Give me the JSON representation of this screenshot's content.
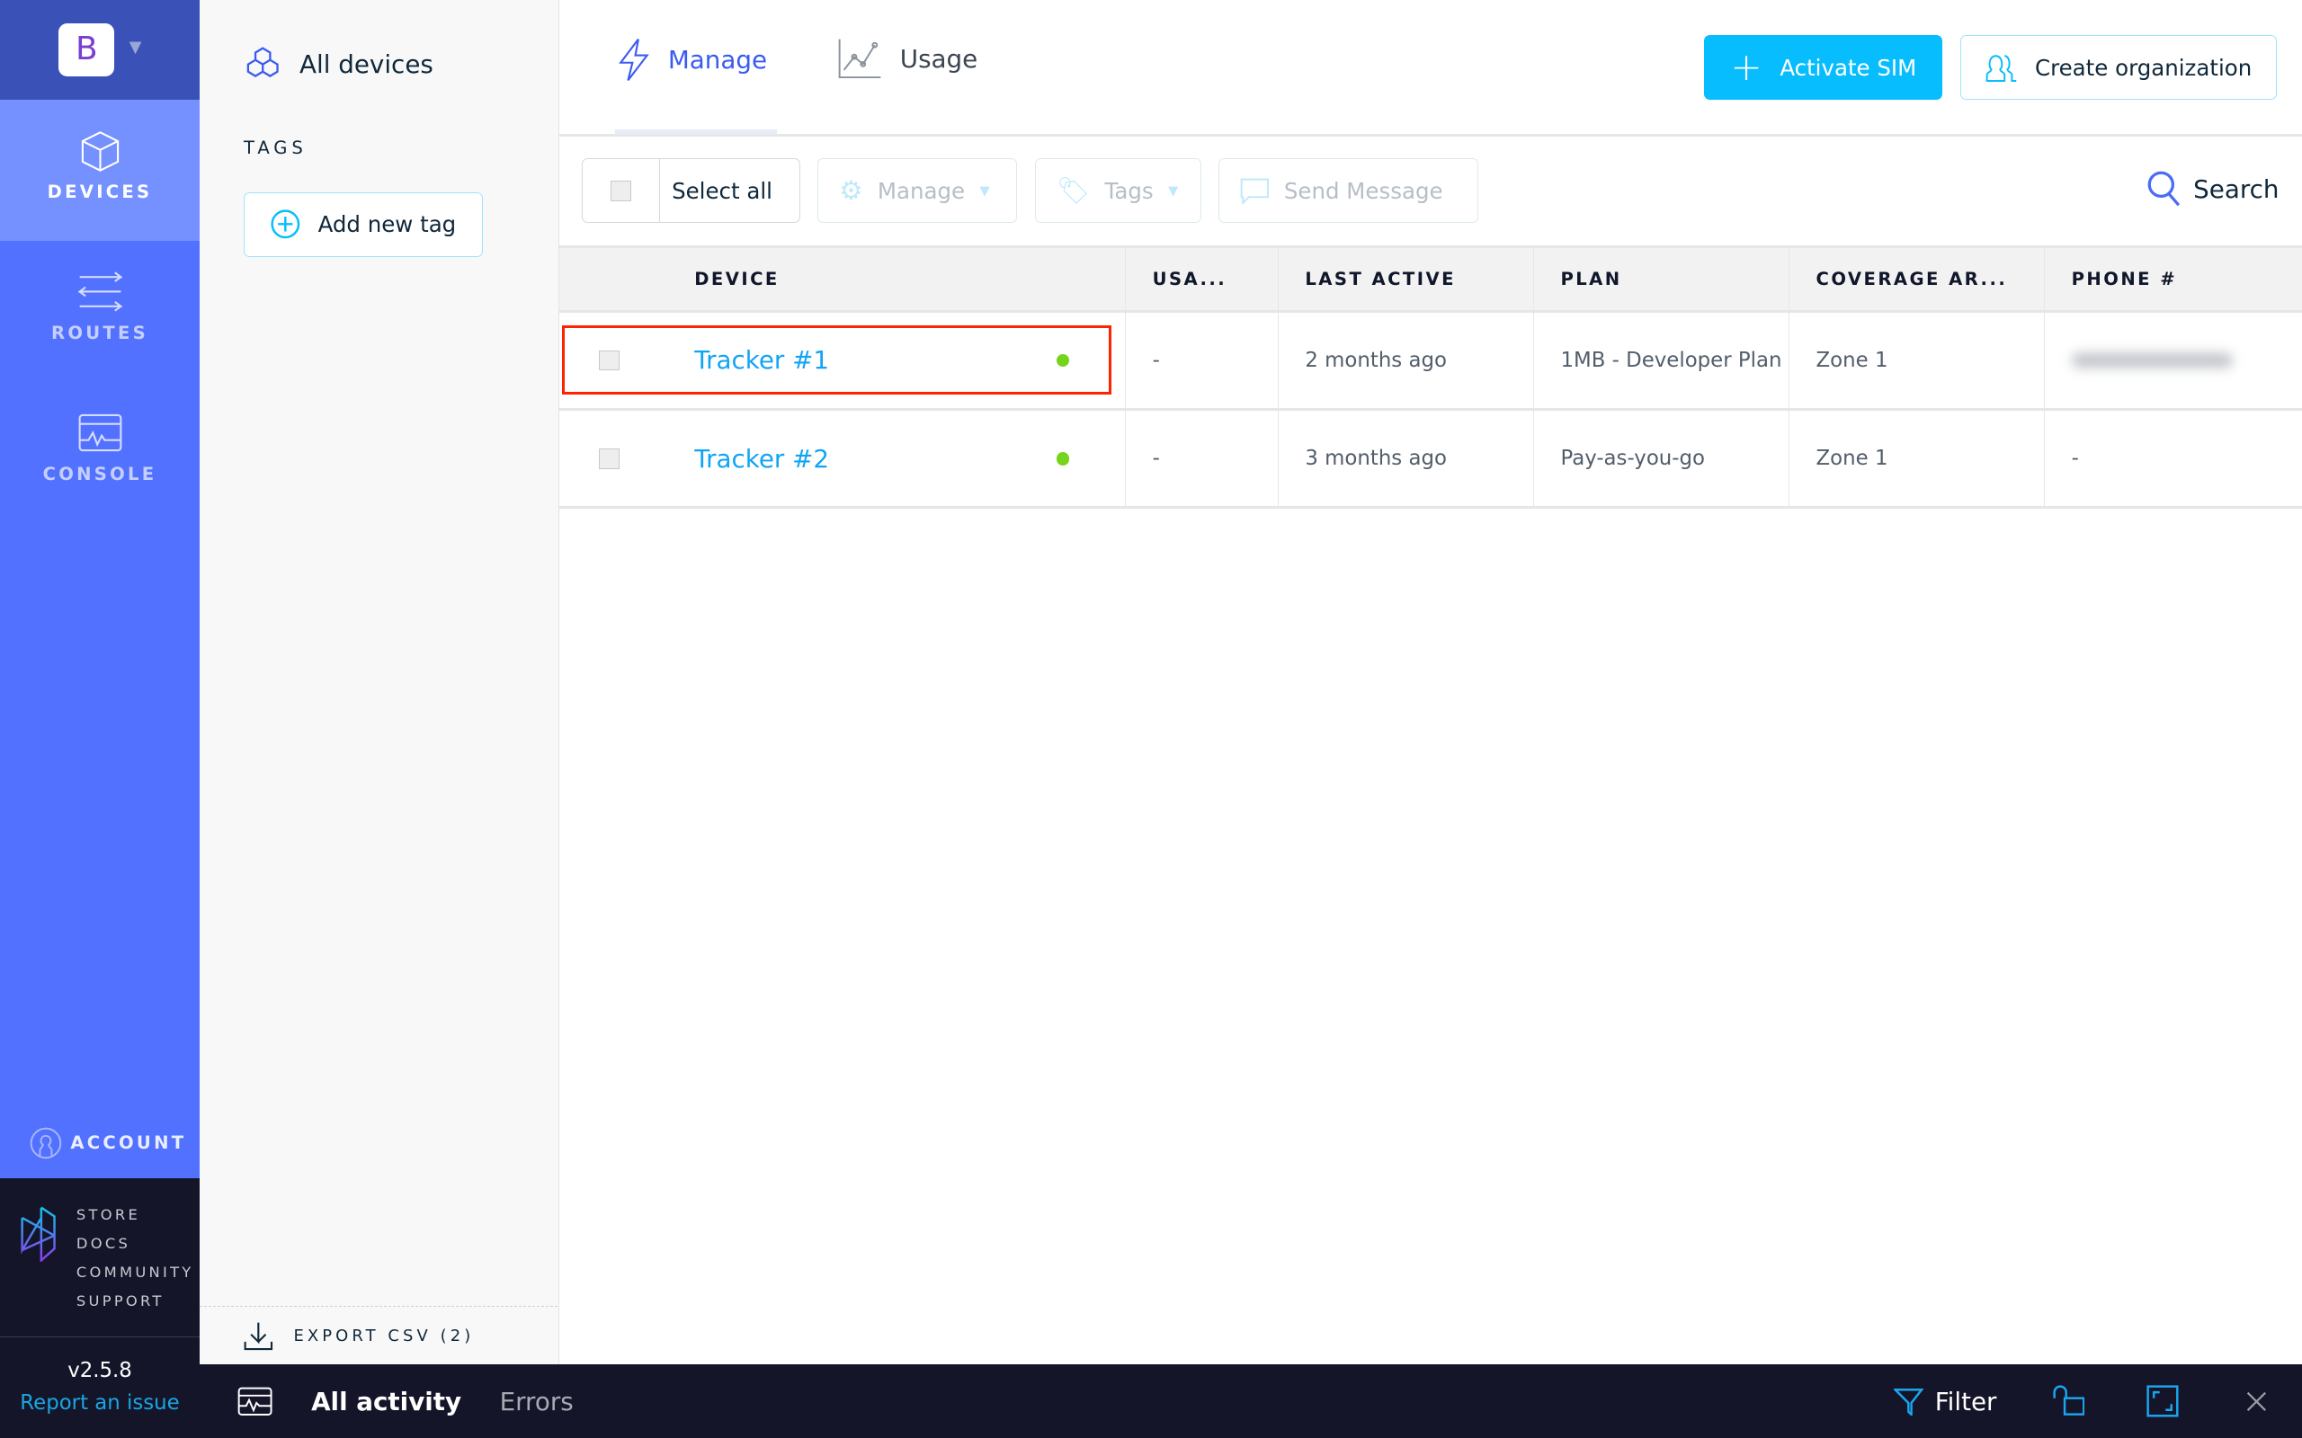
{
  "org": {
    "initial": "B"
  },
  "nav": {
    "items": [
      {
        "label": "DEVICES",
        "active": true
      },
      {
        "label": "ROUTES"
      },
      {
        "label": "CONSOLE"
      }
    ],
    "account": "ACCOUNT",
    "links": [
      "STORE",
      "DOCS",
      "COMMUNITY",
      "SUPPORT"
    ],
    "version": "v2.5.8",
    "report": "Report an issue"
  },
  "panel": {
    "all_devices": "All devices",
    "tags_heading": "TAGS",
    "add_tag": "Add new tag",
    "export": "EXPORT CSV (2)"
  },
  "header": {
    "tabs": [
      {
        "label": "Manage",
        "active": true
      },
      {
        "label": "Usage"
      }
    ],
    "activate": "Activate SIM",
    "create_org": "Create organization"
  },
  "toolbar": {
    "select_all": "Select all",
    "manage": "Manage",
    "tags": "Tags",
    "send": "Send Message",
    "search": "Search"
  },
  "table": {
    "columns": [
      "DEVICE",
      "USA...",
      "LAST ACTIVE",
      "PLAN",
      "COVERAGE AR...",
      "PHONE #"
    ],
    "rows": [
      {
        "device": "Tracker #1",
        "status": "online",
        "usage": "-",
        "last_active": "2 months ago",
        "plan": "1MB - Developer Plan",
        "coverage": "Zone 1",
        "phone": "",
        "phone_redacted": true
      },
      {
        "device": "Tracker #2",
        "status": "online",
        "usage": "-",
        "last_active": "3 months ago",
        "plan": "Pay-as-you-go",
        "coverage": "Zone 1",
        "phone": "-"
      }
    ]
  },
  "bottom": {
    "all_activity": "All activity",
    "errors": "Errors",
    "filter": "Filter"
  },
  "colors": {
    "accent": "#07bdfd",
    "nav": "#5271ff",
    "online": "#76d41d",
    "highlight": "#ff2200"
  }
}
